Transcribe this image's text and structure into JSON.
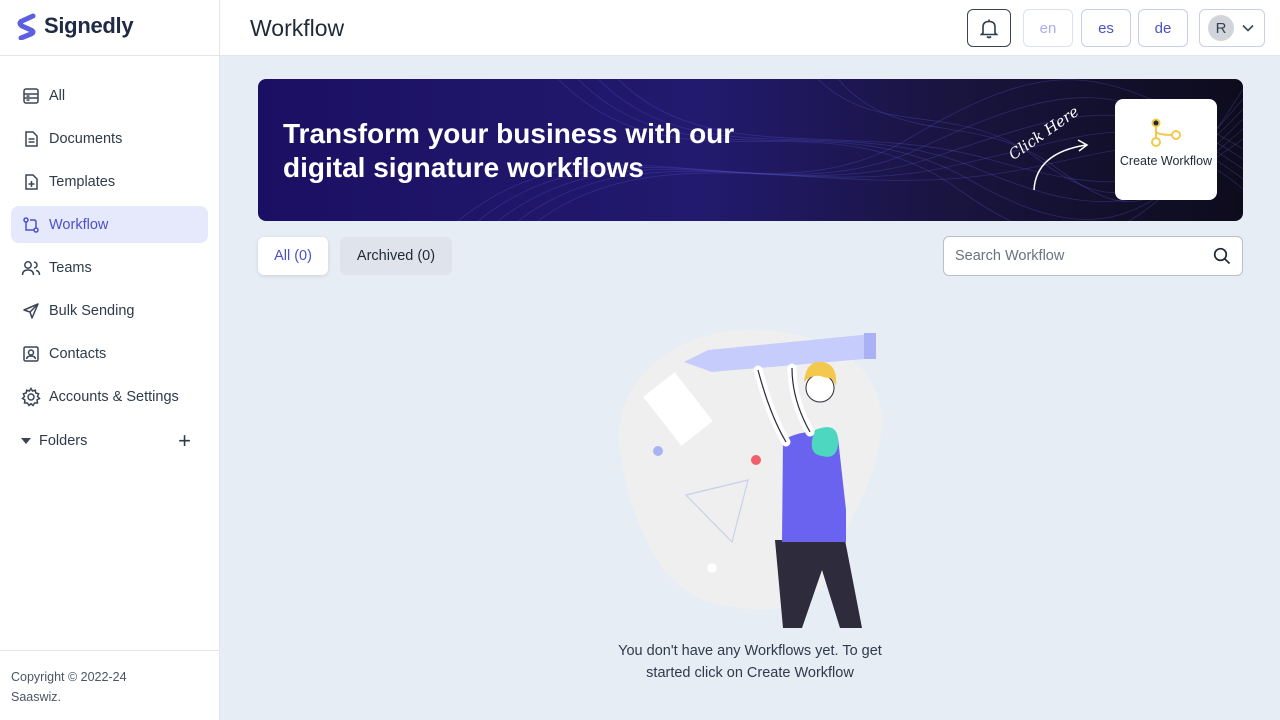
{
  "app": {
    "name": "Signedly"
  },
  "sidebar": {
    "items": [
      {
        "label": "All",
        "icon": "dashboard-icon"
      },
      {
        "label": "Documents",
        "icon": "document-icon"
      },
      {
        "label": "Templates",
        "icon": "template-icon"
      },
      {
        "label": "Workflow",
        "icon": "workflow-icon",
        "active": true
      },
      {
        "label": "Teams",
        "icon": "users-icon"
      },
      {
        "label": "Bulk Sending",
        "icon": "send-icon"
      },
      {
        "label": "Contacts",
        "icon": "contact-icon"
      },
      {
        "label": "Accounts & Settings",
        "icon": "gear-icon"
      }
    ],
    "folders_label": "Folders",
    "copyright": "Copyright © 2022-24 Saaswiz."
  },
  "header": {
    "title": "Workflow",
    "languages": [
      "en",
      "es",
      "de"
    ],
    "user_initial": "R"
  },
  "banner": {
    "title": "Transform your business with our digital signature workflows",
    "click_here": "Click Here",
    "create_label": "Create Workflow"
  },
  "tabs": {
    "all": "All (0)",
    "archived": "Archived (0)"
  },
  "search": {
    "placeholder": "Search Workflow"
  },
  "empty_state": {
    "message": "You don't have any Workflows yet. To get started click on Create Workflow"
  },
  "colors": {
    "accent": "#4b51c8",
    "banner_bg": "#1b0f63",
    "page_bg": "#e7edf5"
  }
}
